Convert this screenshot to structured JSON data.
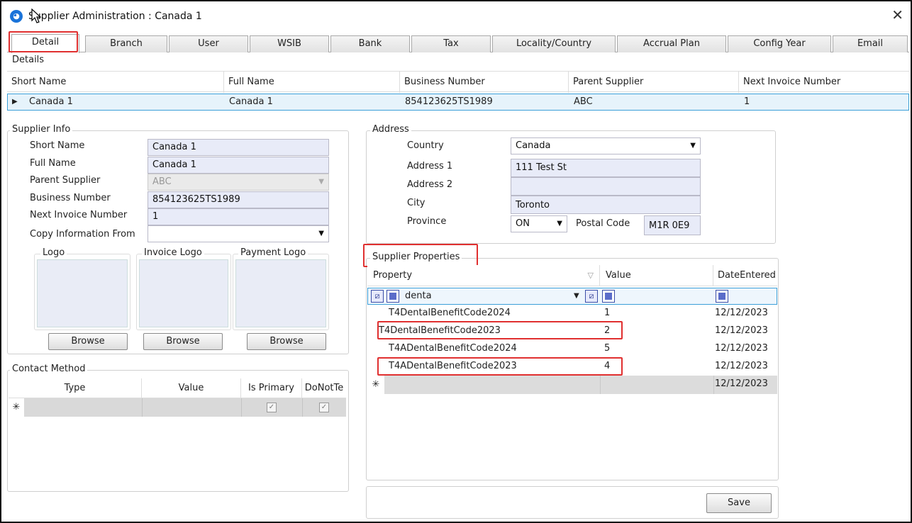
{
  "window": {
    "title": "Supplier Administration : Canada 1",
    "close_glyph": "✕"
  },
  "tabs": [
    {
      "label": "Detail",
      "active": true
    },
    {
      "label": "Branch"
    },
    {
      "label": "User"
    },
    {
      "label": "WSIB"
    },
    {
      "label": "Bank"
    },
    {
      "label": "Tax"
    },
    {
      "label": "Locality/Country"
    },
    {
      "label": "Accrual Plan"
    },
    {
      "label": "Config Year"
    },
    {
      "label": "Email"
    }
  ],
  "details": {
    "legend": "Details",
    "columns": [
      "Short Name",
      "Full Name",
      "Business Number",
      "Parent Supplier",
      "Next Invoice Number"
    ],
    "row": [
      "Canada 1",
      "Canada 1",
      "854123625TS1989",
      "ABC",
      "1"
    ]
  },
  "supplier_info": {
    "legend": "Supplier Info",
    "short_name_label": "Short Name",
    "short_name": "Canada 1",
    "full_name_label": "Full Name",
    "full_name": "Canada 1",
    "parent_supplier_label": "Parent Supplier",
    "parent_supplier": "ABC",
    "business_number_label": "Business Number",
    "business_number": "854123625TS1989",
    "next_invoice_label": "Next Invoice Number",
    "next_invoice": "1",
    "copy_from_label": "Copy Information From",
    "copy_from": "",
    "logo_label": "Logo",
    "invoice_logo_label": "Invoice Logo",
    "payment_logo_label": "Payment Logo",
    "browse_label": "Browse"
  },
  "contact_method": {
    "legend": "Contact Method",
    "columns": [
      "Type",
      "Value",
      "Is Primary",
      "DoNotTe"
    ],
    "new_row_glyph": "✳",
    "check_glyph": "✓"
  },
  "address": {
    "legend": "Address",
    "country_label": "Country",
    "country": "Canada",
    "address1_label": "Address 1",
    "address1": "111 Test St",
    "address2_label": "Address 2",
    "address2": "",
    "city_label": "City",
    "city": "Toronto",
    "province_label": "Province",
    "province": "ON",
    "postal_label": "Postal Code",
    "postal": "M1R 0E9"
  },
  "properties": {
    "legend": "Supplier Properties",
    "columns": [
      "Property",
      "Value",
      "DateEntered"
    ],
    "filter_text": "denta",
    "rows": [
      {
        "property": "T4DentalBenefitCode2024",
        "value": "1",
        "date": "12/12/2023"
      },
      {
        "property": "T4DentalBenefitCode2023",
        "value": "2",
        "date": "12/12/2023"
      },
      {
        "property": "T4ADentalBenefitCode2024",
        "value": "5",
        "date": "12/12/2023"
      },
      {
        "property": "T4ADentalBenefitCode2023",
        "value": "4",
        "date": "12/12/2023"
      }
    ],
    "new_row_glyph": "✳",
    "new_row_date": "12/12/2023"
  },
  "footer": {
    "save_label": "Save"
  },
  "colors": {
    "highlight": "#e03030",
    "selection": "#3b9fd8",
    "field_bg": "#e8ebf8"
  }
}
